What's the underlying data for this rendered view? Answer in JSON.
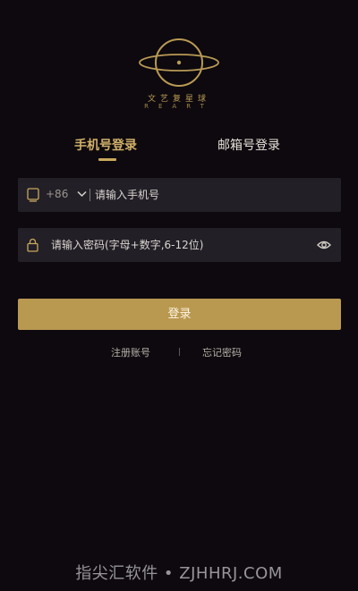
{
  "brand": {
    "name_cn": "文艺复星球",
    "name_en": "REART"
  },
  "tabs": [
    {
      "label": "手机号登录",
      "active": true
    },
    {
      "label": "邮箱号登录",
      "active": false
    }
  ],
  "phone": {
    "country_code": "+86",
    "placeholder": "请输入手机号"
  },
  "password": {
    "placeholder": "请输入密码(字母+数字,6-12位)"
  },
  "login_button": "登录",
  "links": {
    "register": "注册账号",
    "forgot": "忘记密码"
  },
  "watermark": "指尖汇软件 • ZJHHRJ.COM",
  "colors": {
    "background": "#0d090e",
    "accent_gold": "#b99850",
    "field_bg": "#221f27"
  },
  "icons": {
    "logo": "planet-logo",
    "phone_prefix": "device-icon",
    "country_dropdown": "chevron-down-icon",
    "password_prefix": "lock-icon",
    "password_visibility": "eye-icon"
  }
}
